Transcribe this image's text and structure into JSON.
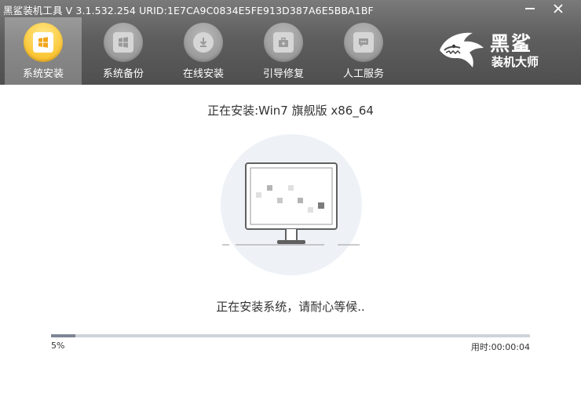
{
  "window": {
    "title": "黑鲨装机工具 V 3.1.532.254 URID:1E7CA9C0834E5FE913D387A6E5BBA1BF",
    "minimize_icon": "minimize-icon",
    "close_icon": "close-icon"
  },
  "nav": {
    "items": [
      {
        "label": "系统安装",
        "icon": "windows-icon",
        "active": true
      },
      {
        "label": "系统备份",
        "icon": "windows-icon",
        "active": false
      },
      {
        "label": "在线安装",
        "icon": "download-icon",
        "active": false
      },
      {
        "label": "引导修复",
        "icon": "toolbox-icon",
        "active": false
      },
      {
        "label": "人工服务",
        "icon": "chat-icon",
        "active": false
      }
    ]
  },
  "brand": {
    "line1": "黑鲨",
    "line2": "装机大师",
    "icon": "shark-logo-icon"
  },
  "main": {
    "install_title": "正在安装:Win7 旗舰版 x86_64",
    "status_text": "正在安装系统，请耐心等候..",
    "progress": {
      "percent": 0.05,
      "percent_label": "5%",
      "elapsed_label": "用时:00:00:04"
    },
    "illustration_icon": "monitor-icon"
  },
  "colors": {
    "header": "#5e5e5e",
    "active_nav": "#fbc738",
    "progress_fill": "#7e8594",
    "progress_track": "#cfd3da"
  }
}
